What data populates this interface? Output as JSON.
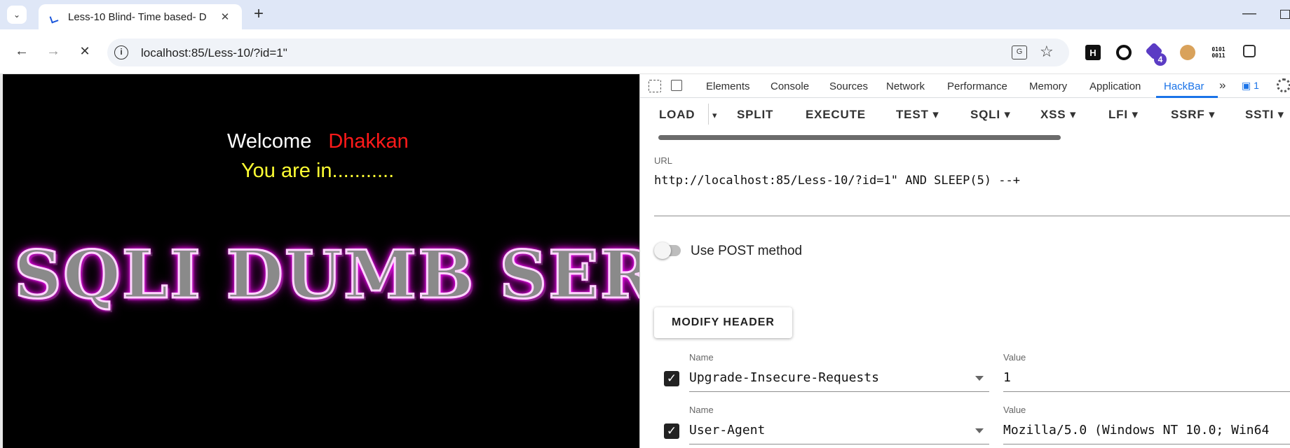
{
  "browser": {
    "tab_title": "Less-10 Blind- Time based- D",
    "address": "localhost:85/Less-10/?id=1\"",
    "extension_badge": "4",
    "translate_glyph": "G",
    "ext_h_glyph": "H",
    "ext_binary": "0101\n0011",
    "glyphs": {
      "back": "←",
      "forward": "→",
      "stop": "✕",
      "new_tab": "+",
      "close_tab": "✕",
      "minimize": "—",
      "star": "☆",
      "tab_search": "⌄"
    }
  },
  "page": {
    "welcome_label": "Welcome",
    "username": "Dhakkan",
    "status_text": "You are in...........",
    "banner_text": "SQLI DUMB SERIES"
  },
  "devtools": {
    "tabs": [
      "Elements",
      "Console",
      "Sources",
      "Network",
      "Performance",
      "Memory",
      "Application",
      "HackBar"
    ],
    "active_tab": "HackBar",
    "more_tabs": "»",
    "issues_count": "1",
    "issues_label": "▣ 1"
  },
  "hackbar": {
    "buttons": {
      "load": "LOAD",
      "split": "SPLIT",
      "execute": "EXECUTE",
      "test": "TEST",
      "sqli": "SQLI",
      "xss": "XSS",
      "lfi": "LFI",
      "ssrf": "SSRF",
      "ssti": "SSTI"
    },
    "caret": "▾",
    "url_label": "URL",
    "url_value": "http://localhost:85/Less-10/?id=1\" AND SLEEP(5) --+",
    "post_toggle_label": "Use POST method",
    "post_enabled": false,
    "modify_header_label": "MODIFY HEADER",
    "headers": [
      {
        "enabled": true,
        "name_label": "Name",
        "name": "Upgrade-Insecure-Requests",
        "value_label": "Value",
        "value": "1"
      },
      {
        "enabled": true,
        "name_label": "Name",
        "name": "User-Agent",
        "value_label": "Value",
        "value": "Mozilla/5.0 (Windows NT 10.0; Win64"
      }
    ]
  },
  "colors": {
    "devtools_accent": "#1a73e8",
    "username_red": "#ff1a1a",
    "status_yellow": "#ffff33",
    "banner_glow": "#ff00ff"
  }
}
